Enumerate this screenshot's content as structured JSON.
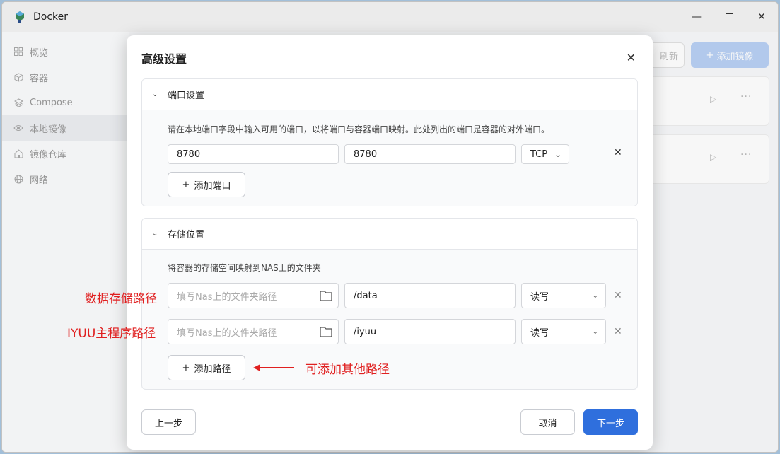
{
  "window": {
    "title": "Docker"
  },
  "sidebar": {
    "items": [
      {
        "label": "概览",
        "icon": "grid-icon"
      },
      {
        "label": "容器",
        "icon": "cube-icon"
      },
      {
        "label": "Compose",
        "icon": "layers-icon"
      },
      {
        "label": "本地镜像",
        "icon": "eye-icon"
      },
      {
        "label": "镜像仓库",
        "icon": "home-icon"
      },
      {
        "label": "网络",
        "icon": "globe-icon"
      }
    ],
    "active_index": 3
  },
  "toolbar": {
    "refresh_label": "刷新",
    "add_image_label": "添加镜像"
  },
  "modal": {
    "title": "高级设置",
    "ports": {
      "header": "端口设置",
      "description": "请在本地端口字段中输入可用的端口，以将端口与容器端口映射。此处列出的端口是容器的对外端口。",
      "rows": [
        {
          "local": "8780",
          "container": "8780",
          "protocol": "TCP"
        }
      ],
      "add_label": "添加端口"
    },
    "storage": {
      "header": "存储位置",
      "description": "将容器的存储空间映射到NAS上的文件夹",
      "rows": [
        {
          "placeholder": "填写Nas上的文件夹路径",
          "container_path": "/data",
          "mode": "读写"
        },
        {
          "placeholder": "填写Nas上的文件夹路径",
          "container_path": "/iyuu",
          "mode": "读写"
        }
      ],
      "add_label": "添加路径"
    },
    "buttons": {
      "prev": "上一步",
      "cancel": "取消",
      "next": "下一步"
    }
  },
  "annotations": {
    "data_path": "数据存储路径",
    "iyuu_path": "IYUU主程序路径",
    "add_other": "可添加其他路径"
  },
  "colors": {
    "accent": "#2f6fdd",
    "annotation": "#e02020"
  }
}
